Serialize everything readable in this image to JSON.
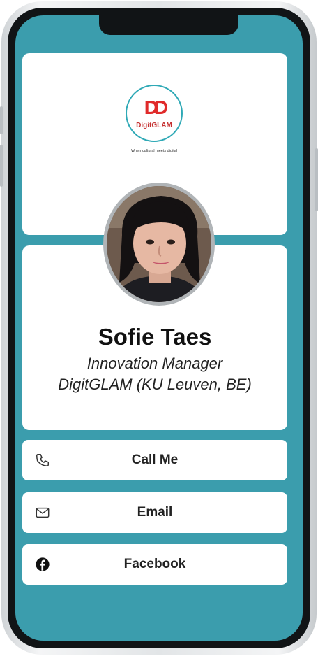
{
  "logo": {
    "mark": "DD",
    "name": "DigitGLAM",
    "tagline": "When cultural meets digital",
    "accent": "#e02a2a",
    "ring": "#2fa9b6"
  },
  "profile": {
    "name": "Sofie Taes",
    "role": "Innovation Manager",
    "organization": "DigitGLAM (KU Leuven, BE)"
  },
  "actions": [
    {
      "label": "Call Me",
      "icon": "phone-icon"
    },
    {
      "label": "Email",
      "icon": "envelope-icon"
    },
    {
      "label": "Facebook",
      "icon": "facebook-icon"
    }
  ],
  "colors": {
    "screen_background": "#3b9dad",
    "card": "#ffffff",
    "text": "#111111"
  }
}
